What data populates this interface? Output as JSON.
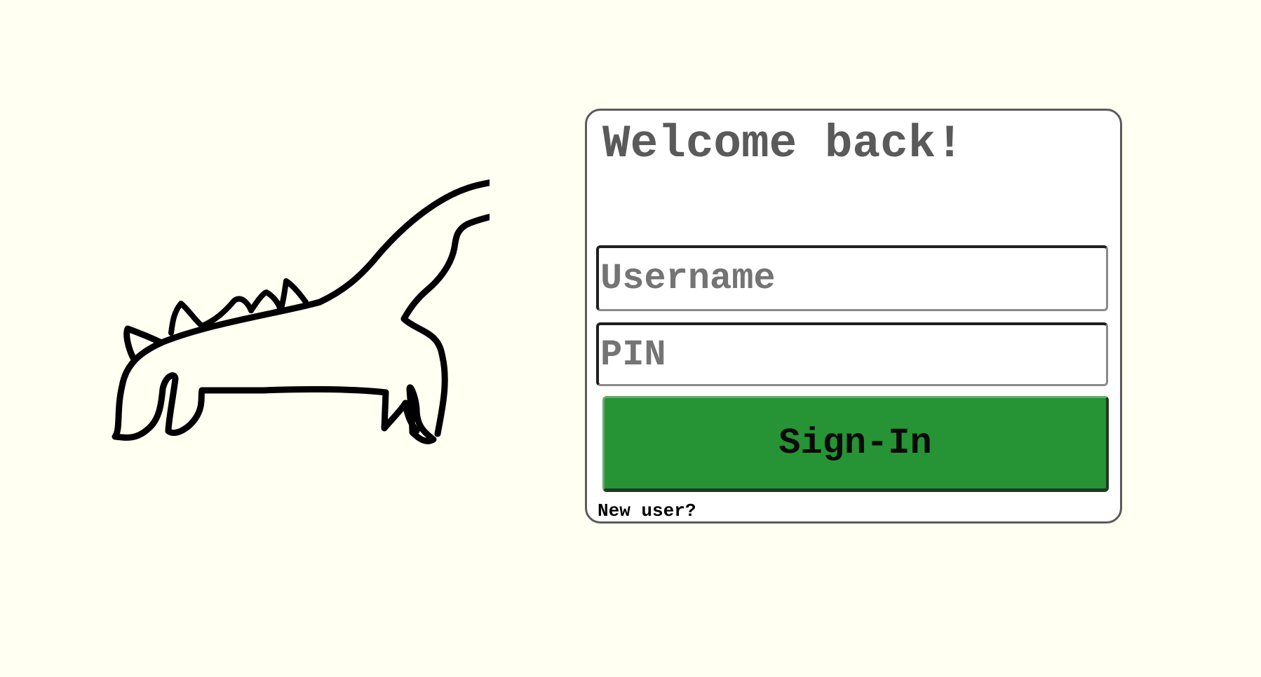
{
  "logo": {
    "icon": "dinosaur-icon"
  },
  "login": {
    "title": "Welcome back!",
    "username_placeholder": "Username",
    "pin_placeholder": "PIN",
    "sign_in_label": "Sign-In",
    "new_user_label": "New user?"
  },
  "colors": {
    "background": "#fffff2",
    "card_border": "#5b5b5b",
    "button": "#269335",
    "title_text": "#5a5a5a"
  }
}
